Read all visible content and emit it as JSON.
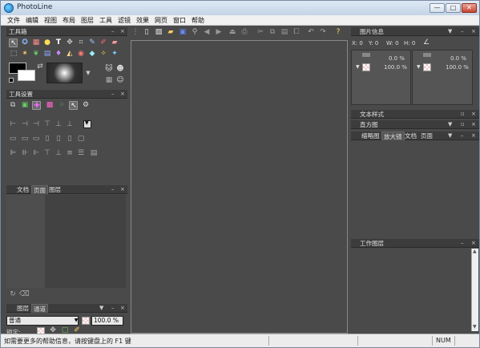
{
  "window": {
    "title": "PhotoLine",
    "min": "—",
    "max": "□",
    "close": "✕"
  },
  "menu": [
    "文件",
    "编辑",
    "视图",
    "布局",
    "图层",
    "工具",
    "滤镜",
    "效果",
    "网页",
    "窗口",
    "帮助"
  ],
  "panels": {
    "toolbox": {
      "title": "工具箱"
    },
    "tool_settings": {
      "title": "工具设置"
    },
    "doc_tabs": [
      "文档",
      "页面",
      "图层"
    ],
    "layers_tabs": [
      "图层",
      "通道"
    ],
    "blend_mode": "普通",
    "opacity": "100.0 %",
    "lock_label": "锁定:",
    "image_info": {
      "title": "图片信息",
      "coords": [
        "X: 0",
        "Y: 0",
        "W: 0",
        "H: 0"
      ],
      "left_percent": "0.0 %",
      "left_full": "100.0 %",
      "right_percent": "0.0 %",
      "right_full": "100.0 %"
    },
    "text_style": {
      "title": "文本样式"
    },
    "histogram": {
      "title": "直方图"
    },
    "nav_tabs": [
      "缩略图",
      "放大镜",
      "文档",
      "页面"
    ],
    "work_layers": {
      "title": "工作图层"
    }
  },
  "status": {
    "help": "如需要更多的帮助信息，请按键盘上的 F1 键",
    "num": "NUM"
  },
  "colors": {
    "accent": "#2a6fc9",
    "panel": "#4a4a4a",
    "header": "#3c3c3c"
  }
}
